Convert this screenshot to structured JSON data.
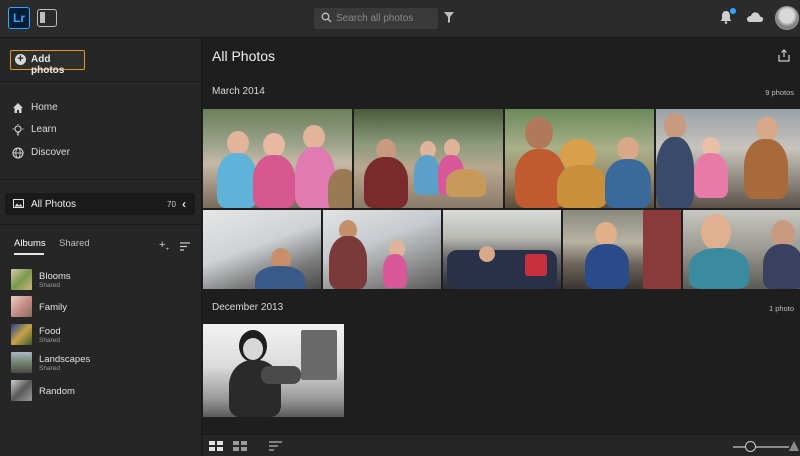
{
  "app": {
    "logo_text": "Lr"
  },
  "toolbar": {
    "search_placeholder": "Search all photos",
    "accent_color": "#31a8ff"
  },
  "sidebar": {
    "add_photos_label": "Add photos",
    "nav": [
      {
        "label": "Home",
        "icon": "home-icon"
      },
      {
        "label": "Learn",
        "icon": "lightbulb-icon"
      },
      {
        "label": "Discover",
        "icon": "globe-icon"
      }
    ],
    "all_photos": {
      "label": "All Photos",
      "count": "70"
    },
    "tabs": [
      {
        "label": "Albums",
        "active": true
      },
      {
        "label": "Shared",
        "active": false
      }
    ],
    "albums": [
      {
        "name": "Blooms",
        "subtitle": "Shared"
      },
      {
        "name": "Family",
        "subtitle": ""
      },
      {
        "name": "Food",
        "subtitle": "Shared"
      },
      {
        "name": "Landscapes",
        "subtitle": "Shared"
      },
      {
        "name": "Random",
        "subtitle": ""
      }
    ]
  },
  "main": {
    "title": "All Photos",
    "sections": [
      {
        "title": "March 2014",
        "count": "9 photos"
      },
      {
        "title": "December 2013",
        "count": "1 photo"
      }
    ]
  },
  "colors": {
    "highlight": "#e39a1c"
  }
}
